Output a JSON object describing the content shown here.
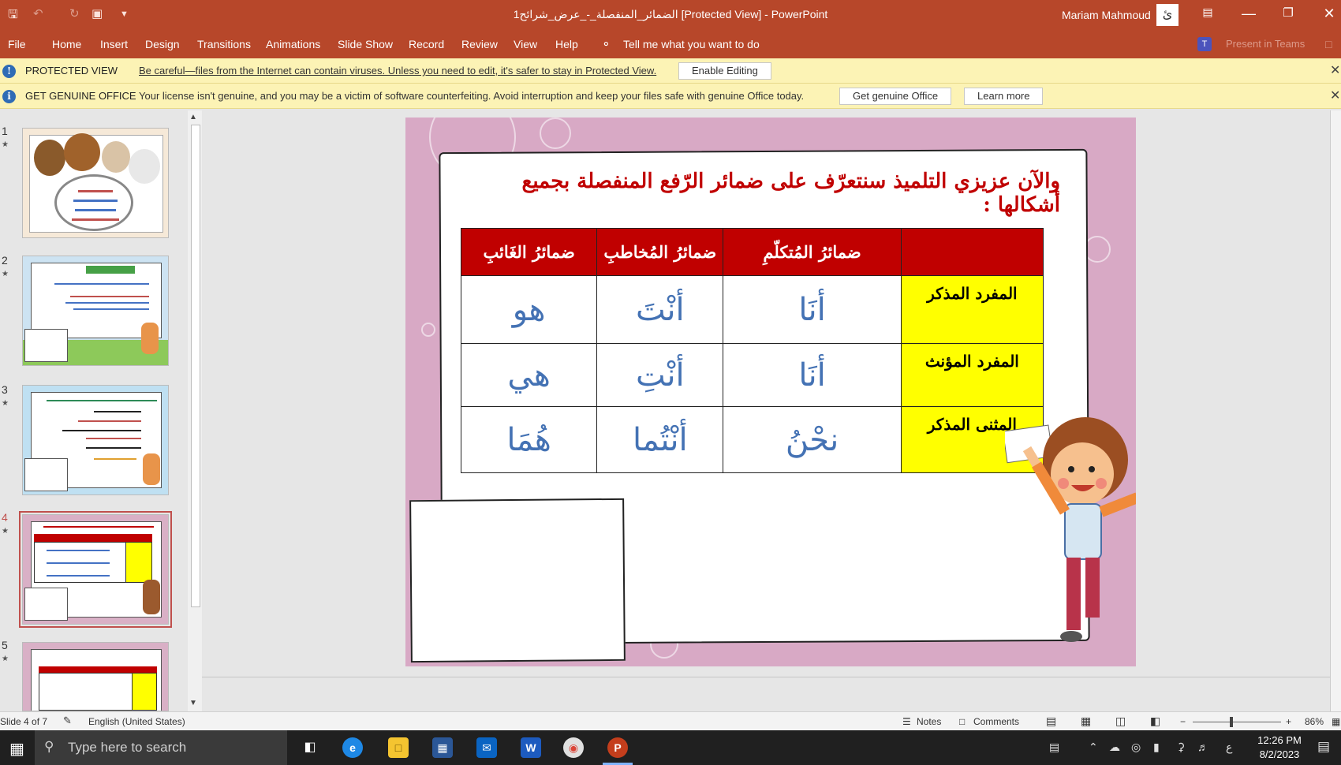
{
  "titlebar": {
    "doc_title": "الضمائر_المنفصلة_-_عرض_شرائح1 [Protected View] - PowerPoint",
    "user_name": "Mariam Mahmoud",
    "avatar_glyph": "ئ"
  },
  "menu": {
    "items": [
      "File",
      "Home",
      "Insert",
      "Design",
      "Transitions",
      "Animations",
      "Slide Show",
      "Record",
      "Review",
      "View",
      "Help"
    ],
    "tell_me": "Tell me what you want to do",
    "present_in_teams": "Present in Teams"
  },
  "protected_bar": {
    "label": "PROTECTED VIEW",
    "message": "Be careful—files from the Internet can contain viruses. Unless you need to edit, it's safer to stay in Protected View.",
    "button": "Enable Editing"
  },
  "genuine_bar": {
    "label": "GET GENUINE OFFICE",
    "message": "Your license isn't genuine, and you may be a victim of software counterfeiting. Avoid interruption and keep your files safe with genuine Office today.",
    "button1": "Get genuine Office",
    "button2": "Learn more"
  },
  "thumbnails": [
    {
      "num": "1"
    },
    {
      "num": "2"
    },
    {
      "num": "3"
    },
    {
      "num": "4"
    },
    {
      "num": "5"
    }
  ],
  "slide": {
    "title": "والآن عزيزي التلميذ سنتعرّف على ضمائر الرّفع المنفصلة بجميع أشكالها :",
    "headers": [
      "ضمائرُ الغَائبِ",
      "ضمائرُ المُخاطبِ",
      "ضمائرُ المُتكلّمِ",
      ""
    ],
    "rows": [
      {
        "label": "المفرد المذكر",
        "speaker": "أنَا",
        "addressee": "أنْتَ",
        "absent": "هو"
      },
      {
        "label": "المفرد المؤنث",
        "speaker": "أنَا",
        "addressee": "أنْتِ",
        "absent": "هي"
      },
      {
        "label": "المثنى المذكر",
        "speaker": "نحْنُ",
        "addressee": "أنْتُما",
        "absent": "هُمَا"
      }
    ]
  },
  "statusbar": {
    "slide_info": "Slide 4 of 7",
    "language": "English (United States)",
    "notes": "Notes",
    "comments": "Comments",
    "zoom": "86%"
  },
  "taskbar": {
    "search_placeholder": "Type here to search",
    "time": "12:26 PM",
    "date": "8/2/2023",
    "lang": "ع"
  }
}
